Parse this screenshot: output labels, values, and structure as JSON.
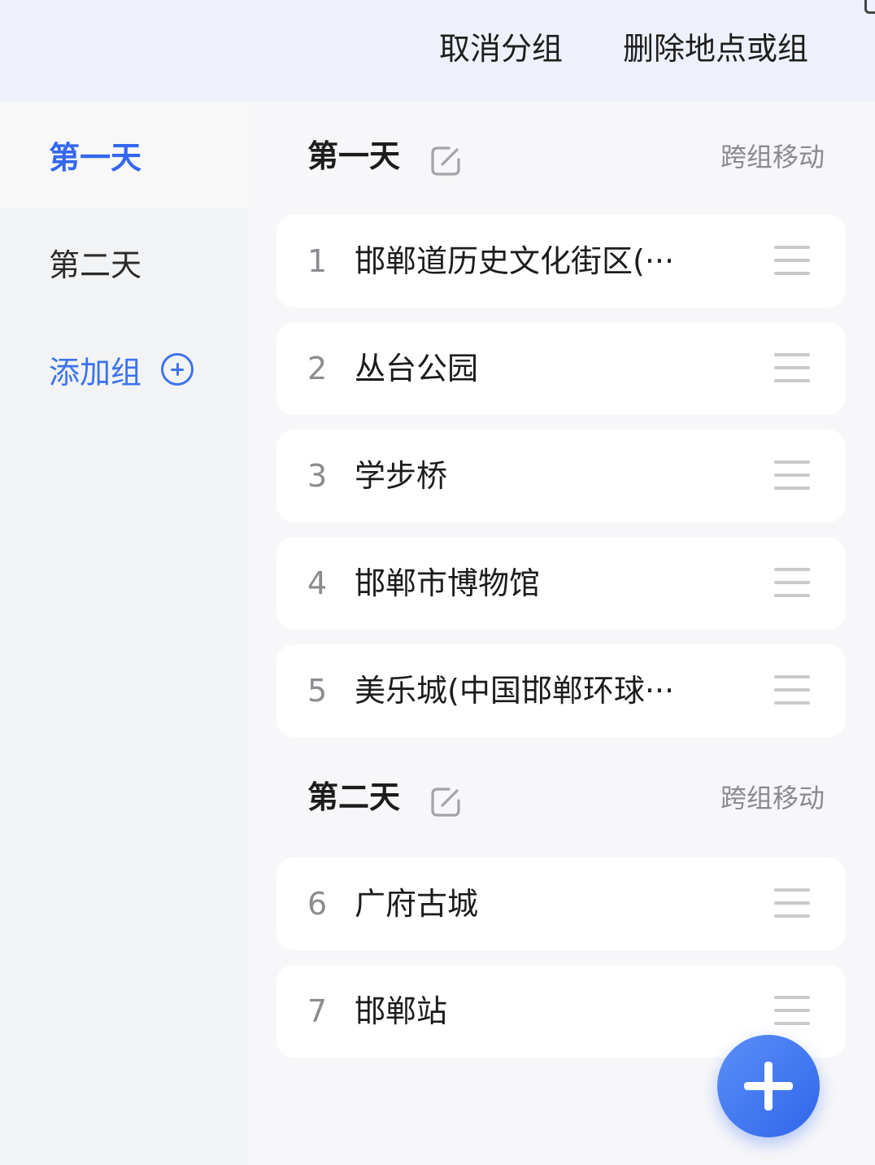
{
  "topbar": {
    "ungroup_label": "取消分组",
    "delete_label": "删除地点或组"
  },
  "sidebar": {
    "items": [
      {
        "label": "第一天",
        "active": true
      },
      {
        "label": "第二天",
        "active": false
      }
    ],
    "add_group_label": "添加组",
    "accent_color": "#3368f0"
  },
  "groups": [
    {
      "title": "第一天",
      "move_label": "跨组移动",
      "places": [
        {
          "num": "1",
          "name": "邯郸道历史文化街区(···"
        },
        {
          "num": "2",
          "name": "丛台公园"
        },
        {
          "num": "3",
          "name": "学步桥"
        },
        {
          "num": "4",
          "name": "邯郸市博物馆"
        },
        {
          "num": "5",
          "name": "美乐城(中国邯郸环球···"
        }
      ]
    },
    {
      "title": "第二天",
      "move_label": "跨组移动",
      "places": [
        {
          "num": "6",
          "name": "广府古城"
        },
        {
          "num": "7",
          "name": "邯郸站"
        }
      ]
    }
  ],
  "icons": {
    "edit": "edit-icon",
    "drag": "drag-handle-icon",
    "add_circle": "plus-circle-icon",
    "fab": "plus-icon"
  }
}
